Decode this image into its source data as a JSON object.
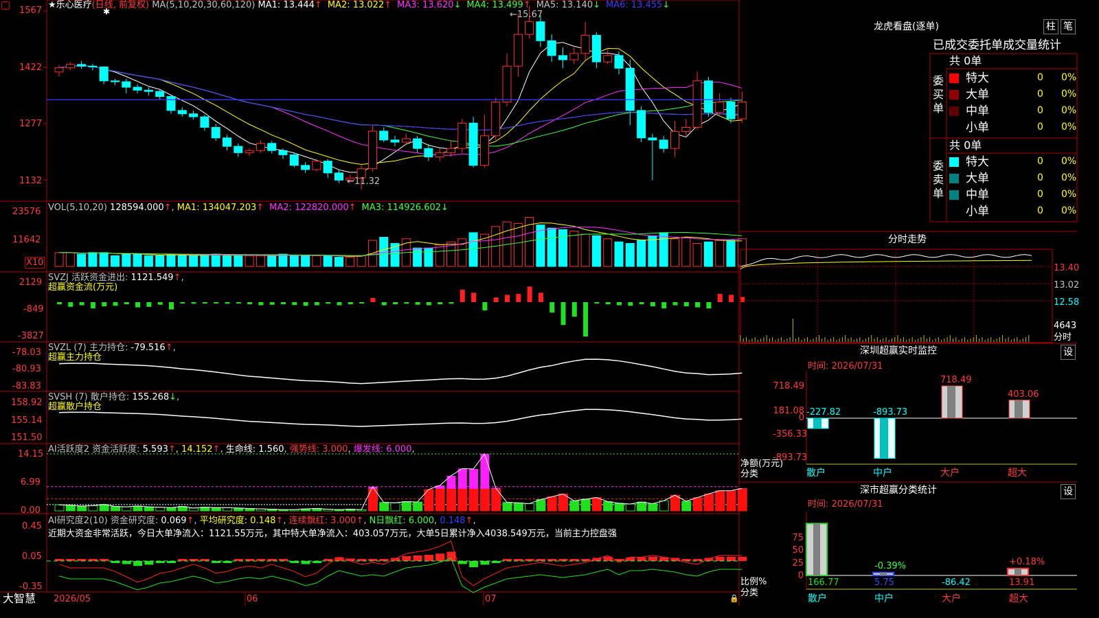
{
  "stock": {
    "name": "★乐心医疗",
    "period": "(日线, 前复权)",
    "ma_label": "MA(5,10,20,30,60,120)",
    "ma_values": [
      {
        "label": "MA1:",
        "value": "13.444",
        "arrow": "↑",
        "color": "#ffffff"
      },
      {
        "label": "MA2:",
        "value": "13.022",
        "arrow": "↑",
        "color": "#ffff00"
      },
      {
        "label": "MA3:",
        "value": "13.620",
        "arrow": "↓",
        "color": "#ff30ff"
      },
      {
        "label": "MA4:",
        "value": "13.499",
        "arrow": "↑",
        "color": "#40ff40"
      },
      {
        "label": "MA5:",
        "value": "13.140",
        "arrow": "↓",
        "color": "#c0c0c0"
      },
      {
        "label": "MA6:",
        "value": "13.455",
        "arrow": "↓",
        "color": "#3c3cff"
      }
    ],
    "price_axis": [
      "1567",
      "1422",
      "1277",
      "1132"
    ],
    "high_label": "15.67",
    "low_label": "11.32"
  },
  "volume": {
    "label": "VOL(5,10,20)",
    "value": "128594.000",
    "ma_values": [
      {
        "label": "MA1:",
        "value": "134047.203",
        "arrow": "↑",
        "color": "#ffff00"
      },
      {
        "label": "MA2:",
        "value": "122820.000",
        "arrow": "↑",
        "color": "#ff30ff"
      },
      {
        "label": "MA3:",
        "value": "114926.602",
        "arrow": "↓",
        "color": "#40ff40"
      }
    ],
    "axis": [
      "23576",
      "11642"
    ],
    "unit": "X10"
  },
  "svzj": {
    "label": "SVZJ  活跃资金进出:",
    "value": "1121.549",
    "sub": "超赢资金流(万元)",
    "axis": [
      "2129",
      "-849",
      "-3827"
    ]
  },
  "svzl": {
    "label": "SVZL (7) 主力持仓:",
    "value": "-79.516",
    "sub": "超赢主力持仓",
    "axis": [
      "-78.03",
      "-80.93",
      "-83.83"
    ]
  },
  "svsh": {
    "label": "SVSH (7) 散户持仓:",
    "value": "155.268",
    "sub": "超赢散户持仓",
    "axis": [
      "158.92",
      "155.14",
      "151.50"
    ]
  },
  "ai_active": {
    "label": "AI活跃度2 资金活跃度:",
    "value": "5.593",
    "v2": "14.152",
    "life_label": "生命线:",
    "life": "1.560",
    "strong": "强势线: 3.000",
    "burst": "爆发线: 6.000",
    "axis": [
      "14.15",
      "6.99",
      "0.00"
    ]
  },
  "ai_research": {
    "label": "AI研究度2(10) 资金研究度:",
    "value": "0.069",
    "avg_label": "平均研究度:",
    "avg": "0.148",
    "red_label": "连续飘红:",
    "red": "3.000",
    "nred_label": "N日飘红:",
    "nred": "6.000",
    "last": "0.148",
    "note": "近期大资金非常活跃，今日大单净流入：1121.55万元，其中特大单净流入：403.057万元，大单5日累计净入4038.549万元，当前主力控盘强",
    "axis": [
      "0.45",
      "0.05",
      "-0.35"
    ]
  },
  "date_axis": {
    "brand": "大智慧",
    "labels": [
      "2026/05",
      "06",
      "07"
    ]
  },
  "longhu": {
    "title": "龙虎看盘(逐单)",
    "btn1": "柱",
    "btn2": "笔",
    "header": "已成交委托单成交量统计",
    "buy_side": "委买单",
    "sell_side": "委卖单",
    "buy_total": "共 0单",
    "sell_total": "共 0单",
    "buy_rows": [
      {
        "name": "特大",
        "count": "0",
        "pct": "0%",
        "color": "#ff0000"
      },
      {
        "name": "大单",
        "count": "0",
        "pct": "0%",
        "color": "#900000"
      },
      {
        "name": "中单",
        "count": "0",
        "pct": "0%",
        "color": "#600000"
      },
      {
        "name": "小单",
        "count": "0",
        "pct": "0%",
        "color": ""
      }
    ],
    "sell_rows": [
      {
        "name": "特大",
        "count": "0",
        "pct": "0%",
        "color": "#00ffff"
      },
      {
        "name": "大单",
        "count": "0",
        "pct": "0%",
        "color": "#008080"
      },
      {
        "name": "中单",
        "count": "0",
        "pct": "0%",
        "color": "#008080"
      },
      {
        "name": "小单",
        "count": "0",
        "pct": "0%",
        "color": ""
      }
    ]
  },
  "intraday": {
    "title": "分时走势",
    "axis": [
      "13.40",
      "13.02",
      "12.58",
      "4643"
    ],
    "vol_unit": "分时"
  },
  "sz_monitor": {
    "title": "深圳超赢实时监控",
    "btn": "设",
    "time": "时间: 2026/07/31",
    "axis": [
      "718.49",
      "181.08",
      "0",
      "-356.33",
      "-893.73"
    ],
    "ylabel": "净额(万元)",
    "xlabel": "分类",
    "bars": [
      {
        "cat": "散户",
        "value": -227.82,
        "label": "-227.82"
      },
      {
        "cat": "中户",
        "value": -893.73,
        "label": "-893.73"
      },
      {
        "cat": "大户",
        "value": 718.49,
        "label": "718.49"
      },
      {
        "cat": "超大",
        "value": 403.06,
        "label": "403.06"
      }
    ]
  },
  "sz_class": {
    "title": "深市超赢分类统计",
    "btn": "设",
    "time": "时间: 2026/07/31",
    "axis": [
      "75",
      "50",
      "25",
      "0"
    ],
    "ylabel": "比例%",
    "xlabel": "分类",
    "bars": [
      {
        "cat": "散户",
        "value": 166.77,
        "change": "",
        "vlabel": "166.77"
      },
      {
        "cat": "中户",
        "value": 5.75,
        "change": "-0.39%",
        "vlabel": "5.75"
      },
      {
        "cat": "大户",
        "value": -86.42,
        "change": "",
        "vlabel": "-86.42"
      },
      {
        "cat": "超大",
        "value": 13.91,
        "change": "+0.18%",
        "vlabel": "13.91"
      }
    ]
  },
  "chart_data": {
    "type": "candlestick",
    "candles": [
      [
        14.11,
        14.21,
        14.28,
        14.0
      ],
      [
        14.21,
        14.29,
        14.35,
        14.15
      ],
      [
        14.29,
        14.25,
        14.37,
        14.18
      ],
      [
        14.25,
        14.23,
        14.3,
        14.15
      ],
      [
        14.23,
        13.9,
        14.25,
        13.82
      ],
      [
        13.9,
        13.88,
        13.95,
        13.8
      ],
      [
        13.88,
        13.75,
        13.95,
        13.6
      ],
      [
        13.75,
        13.68,
        13.82,
        13.6
      ],
      [
        13.68,
        13.65,
        13.75,
        13.55
      ],
      [
        13.65,
        13.53,
        13.7,
        13.45
      ],
      [
        13.53,
        13.2,
        13.56,
        13.12
      ],
      [
        13.2,
        13.12,
        13.28,
        13.05
      ],
      [
        13.12,
        13.05,
        13.2,
        12.98
      ],
      [
        13.05,
        12.8,
        13.1,
        12.72
      ],
      [
        12.8,
        12.55,
        12.88,
        12.48
      ],
      [
        12.55,
        12.35,
        12.62,
        12.25
      ],
      [
        12.35,
        12.2,
        12.42,
        12.1
      ],
      [
        12.2,
        12.25,
        12.3,
        12.12
      ],
      [
        12.25,
        12.42,
        12.5,
        12.2
      ],
      [
        12.42,
        12.25,
        12.48,
        12.18
      ],
      [
        12.25,
        12.15,
        12.3,
        12.05
      ],
      [
        12.15,
        11.9,
        12.2,
        11.85
      ],
      [
        11.9,
        11.8,
        11.98,
        11.72
      ],
      [
        11.8,
        12.0,
        12.05,
        11.75
      ],
      [
        12.0,
        11.72,
        12.05,
        11.6
      ],
      [
        11.72,
        11.55,
        11.8,
        11.48
      ],
      [
        11.55,
        11.6,
        11.68,
        11.5
      ],
      [
        11.6,
        11.82,
        11.9,
        11.32
      ],
      [
        11.82,
        12.71,
        12.85,
        11.75
      ],
      [
        12.71,
        12.5,
        12.8,
        12.45
      ],
      [
        12.5,
        12.45,
        12.6,
        12.35
      ],
      [
        12.45,
        12.53,
        12.65,
        12.4
      ],
      [
        12.53,
        12.3,
        12.6,
        12.2
      ],
      [
        12.3,
        12.1,
        12.4,
        12.0
      ],
      [
        12.1,
        12.2,
        12.3,
        12.0
      ],
      [
        12.2,
        12.3,
        12.5,
        12.1
      ],
      [
        12.3,
        12.9,
        13.0,
        12.2
      ],
      [
        12.9,
        11.9,
        13.05,
        11.85
      ],
      [
        11.9,
        12.6,
        13.1,
        11.85
      ],
      [
        12.6,
        13.4,
        13.5,
        12.5
      ],
      [
        13.4,
        14.25,
        14.55,
        13.3
      ],
      [
        14.25,
        15.0,
        15.5,
        14.0
      ],
      [
        15.0,
        15.3,
        15.67,
        14.9
      ],
      [
        15.3,
        14.85,
        15.45,
        14.7
      ],
      [
        14.85,
        14.5,
        15.0,
        14.35
      ],
      [
        14.5,
        14.4,
        14.7,
        14.2
      ],
      [
        14.4,
        14.55,
        14.7,
        14.3
      ],
      [
        14.55,
        14.98,
        15.3,
        14.4
      ],
      [
        14.98,
        14.35,
        15.05,
        14.2
      ],
      [
        14.35,
        14.5,
        14.65,
        14.3
      ],
      [
        14.5,
        14.2,
        14.6,
        14.05
      ],
      [
        14.2,
        13.2,
        14.4,
        12.85
      ],
      [
        13.2,
        12.55,
        13.3,
        12.45
      ],
      [
        12.55,
        12.5,
        12.65,
        11.55
      ],
      [
        12.5,
        12.3,
        12.6,
        12.2
      ],
      [
        12.3,
        12.7,
        12.95,
        12.1
      ],
      [
        12.7,
        12.8,
        13.0,
        12.6
      ],
      [
        12.8,
        13.9,
        14.12,
        12.75
      ],
      [
        13.9,
        13.15,
        14.0,
        13.05
      ],
      [
        13.15,
        13.4,
        13.6,
        13.1
      ],
      [
        13.4,
        13.0,
        13.5,
        12.9
      ],
      [
        13.0,
        13.4,
        13.65,
        12.9
      ]
    ],
    "volume": [
      9,
      9,
      8,
      9,
      9,
      7,
      8,
      8,
      7,
      7,
      8,
      7,
      7,
      7,
      8,
      7,
      7,
      7,
      7,
      7,
      8,
      7,
      7,
      7,
      7,
      6,
      6,
      7,
      17,
      19,
      15,
      18,
      12,
      12,
      14,
      16,
      18,
      22,
      21,
      26,
      29,
      28,
      32,
      27,
      25,
      24,
      23,
      21,
      20,
      18,
      16,
      15,
      17,
      20,
      22,
      18,
      19,
      15,
      16,
      17,
      17,
      18
    ],
    "svzj": [
      -200,
      -450,
      -300,
      -600,
      -400,
      -350,
      -200,
      -500,
      -450,
      -250,
      -700,
      -100,
      -150,
      -80,
      -100,
      -150,
      -120,
      -200,
      -300,
      -250,
      -200,
      -280,
      -350,
      -300,
      -150,
      -300,
      -200,
      -100,
      400,
      -300,
      -200,
      -150,
      -250,
      -300,
      -200,
      -150,
      1200,
      900,
      -800,
      450,
      700,
      800,
      1500,
      900,
      -1000,
      -2200,
      -1400,
      -3300,
      -100,
      -200,
      -300,
      -350,
      -200,
      -400,
      -600,
      -300,
      -400,
      -500,
      -600,
      800,
      700,
      500
    ],
    "ai_active": [
      1.5,
      1.4,
      1.2,
      1.3,
      1.6,
      1.1,
      1.0,
      1.2,
      1.0,
      0.9,
      0.8,
      1.1,
      0.7,
      0.9,
      0.8,
      0.8,
      0.7,
      0.6,
      0.5,
      0.4,
      0.3,
      0.3,
      0.5,
      0.6,
      0.4,
      0.3,
      0.4,
      0.3,
      6.0,
      2.1,
      2.0,
      2.3,
      2.2,
      5.3,
      6.3,
      8.7,
      10.5,
      10.4,
      14.15,
      5.7,
      2.1,
      2.0,
      1.8,
      2.8,
      3.5,
      4.2,
      2.5,
      2.9,
      3.3,
      2.3,
      1.9,
      1.7,
      2.2,
      1.8,
      2.5,
      3.9,
      2.4,
      3.3,
      4.2,
      5.0,
      5.0,
      5.59
    ],
    "research": [
      0.02,
      0.0,
      0.0,
      0.0,
      0.0,
      -0.02,
      -0.05,
      -0.08,
      -0.06,
      -0.03,
      -0.02,
      0.0,
      0.02,
      0.0,
      -0.03,
      -0.02,
      0.0,
      0.01,
      0.0,
      0.02,
      0.0,
      -0.02,
      -0.05,
      -0.03,
      0.02,
      0.06,
      0.04,
      0.02,
      0.03,
      0.02,
      0.05,
      0.08,
      0.09,
      0.1,
      0.12,
      0.15,
      -0.05,
      -0.1,
      -0.06,
      -0.03,
      0.0,
      0.01,
      0.02,
      0.03,
      0.02,
      0.01,
      0.02,
      0.03,
      0.05,
      0.07,
      0.03,
      0.06,
      0.06,
      0.07,
      0.06,
      0.05,
      0.03,
      0.02,
      0.05,
      0.07,
      0.07,
      0.069
    ]
  }
}
